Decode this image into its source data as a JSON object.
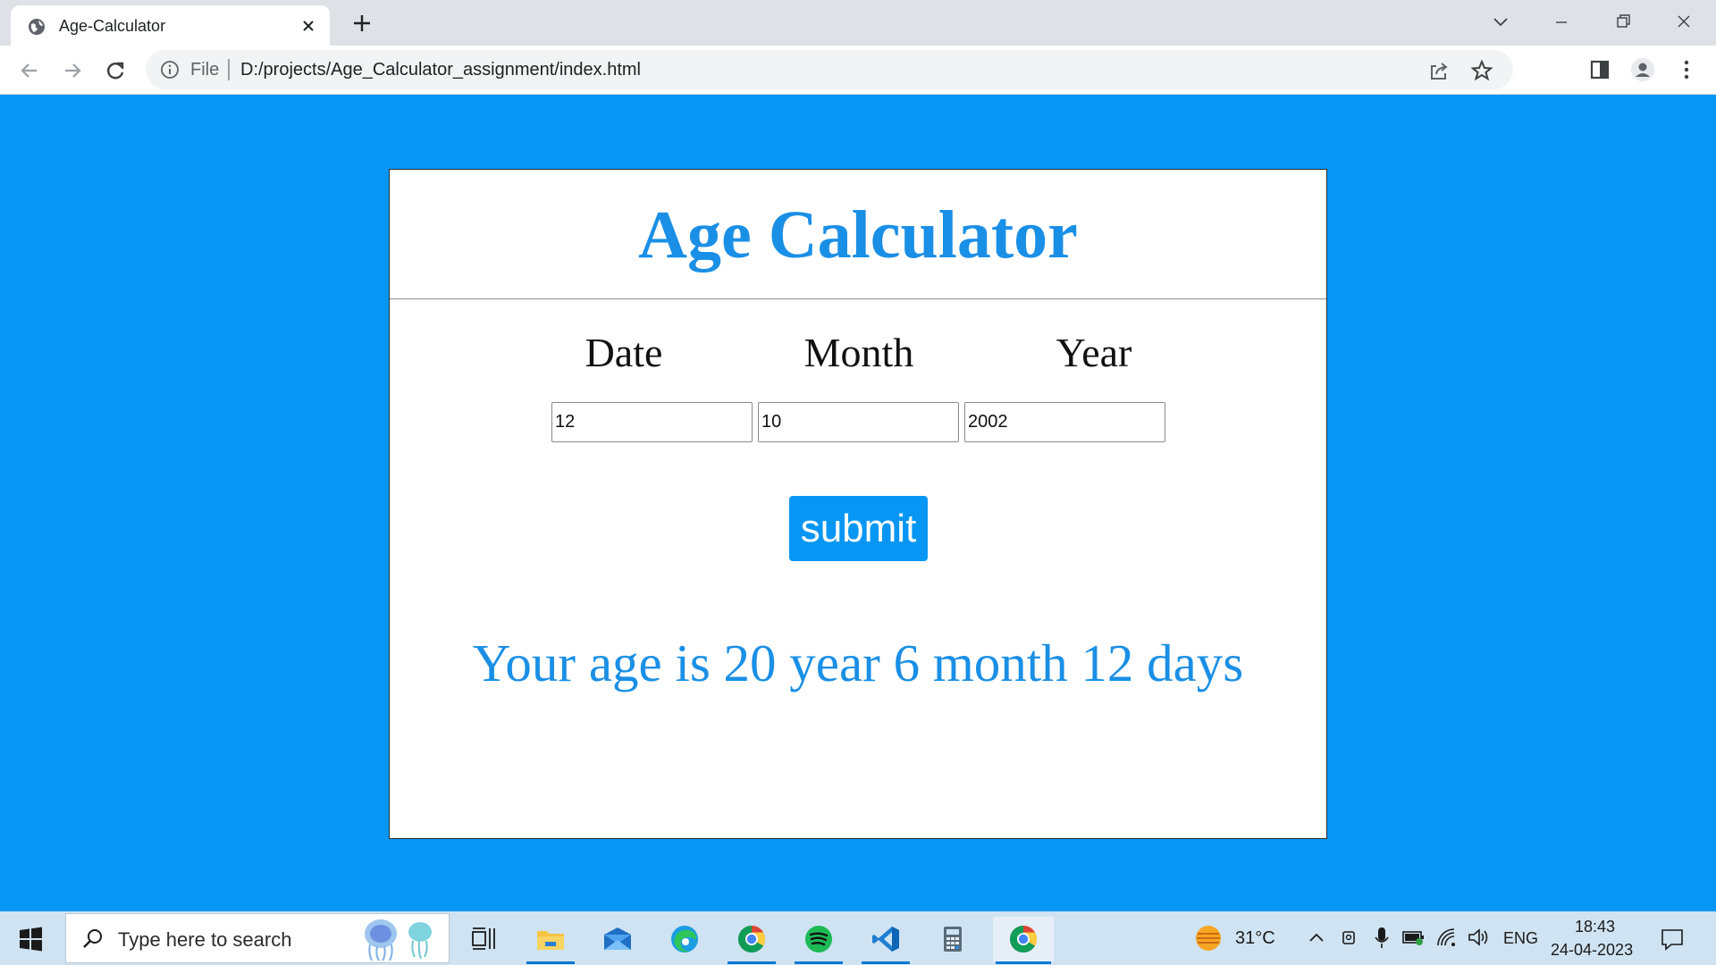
{
  "browser": {
    "tab_title": "Age-Calculator",
    "scheme_label": "File",
    "url": "D:/projects/Age_Calculator_assignment/index.html"
  },
  "app": {
    "title": "Age Calculator",
    "labels": {
      "date": "Date",
      "month": "Month",
      "year": "Year"
    },
    "inputs": {
      "date": "12",
      "month": "10",
      "year": "2002"
    },
    "submit_label": "submit",
    "result": "Your age is 20 year 6 month 12 days"
  },
  "taskbar": {
    "search_placeholder": "Type here to search",
    "weather": "31°C",
    "language": "ENG",
    "time": "18:43",
    "date": "24-04-2023",
    "apps": [
      "task-view",
      "file-explorer",
      "mail",
      "edge",
      "chrome",
      "spotify",
      "vscode",
      "calculator",
      "chrome-active"
    ]
  },
  "colors": {
    "page_background": "#0796f3",
    "accent": "#1a8fe6",
    "button": "#0796f3"
  }
}
